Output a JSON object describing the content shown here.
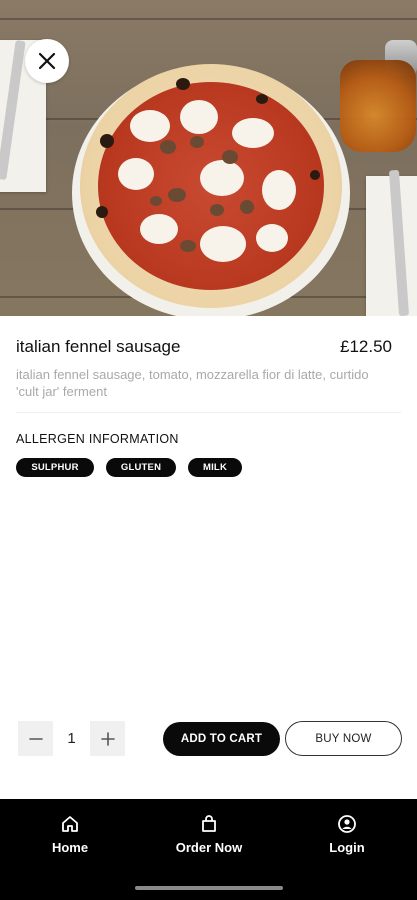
{
  "product": {
    "title": "italian fennel sausage",
    "price": "£12.50",
    "description": "italian fennel sausage, tomato, mozzarella fior di latte, curtido 'cult jar' ferment"
  },
  "allergens": {
    "heading": "ALLERGEN INFORMATION",
    "items": [
      "SULPHUR",
      "GLUTEN",
      "MILK"
    ]
  },
  "cart": {
    "quantity": "1",
    "add_label": "ADD TO CART",
    "buy_label": "BUY NOW"
  },
  "bottom_nav": {
    "items": [
      {
        "label": "Home",
        "icon": "home-icon"
      },
      {
        "label": "Order Now",
        "icon": "shopping-bag-icon"
      },
      {
        "label": "Login",
        "icon": "user-icon"
      }
    ]
  },
  "icons": {
    "close": "close-icon",
    "minus": "minus-icon",
    "plus": "plus-icon"
  },
  "colors": {
    "primary": "#000000",
    "background": "#ffffff",
    "muted_text": "#a9a9a9"
  }
}
